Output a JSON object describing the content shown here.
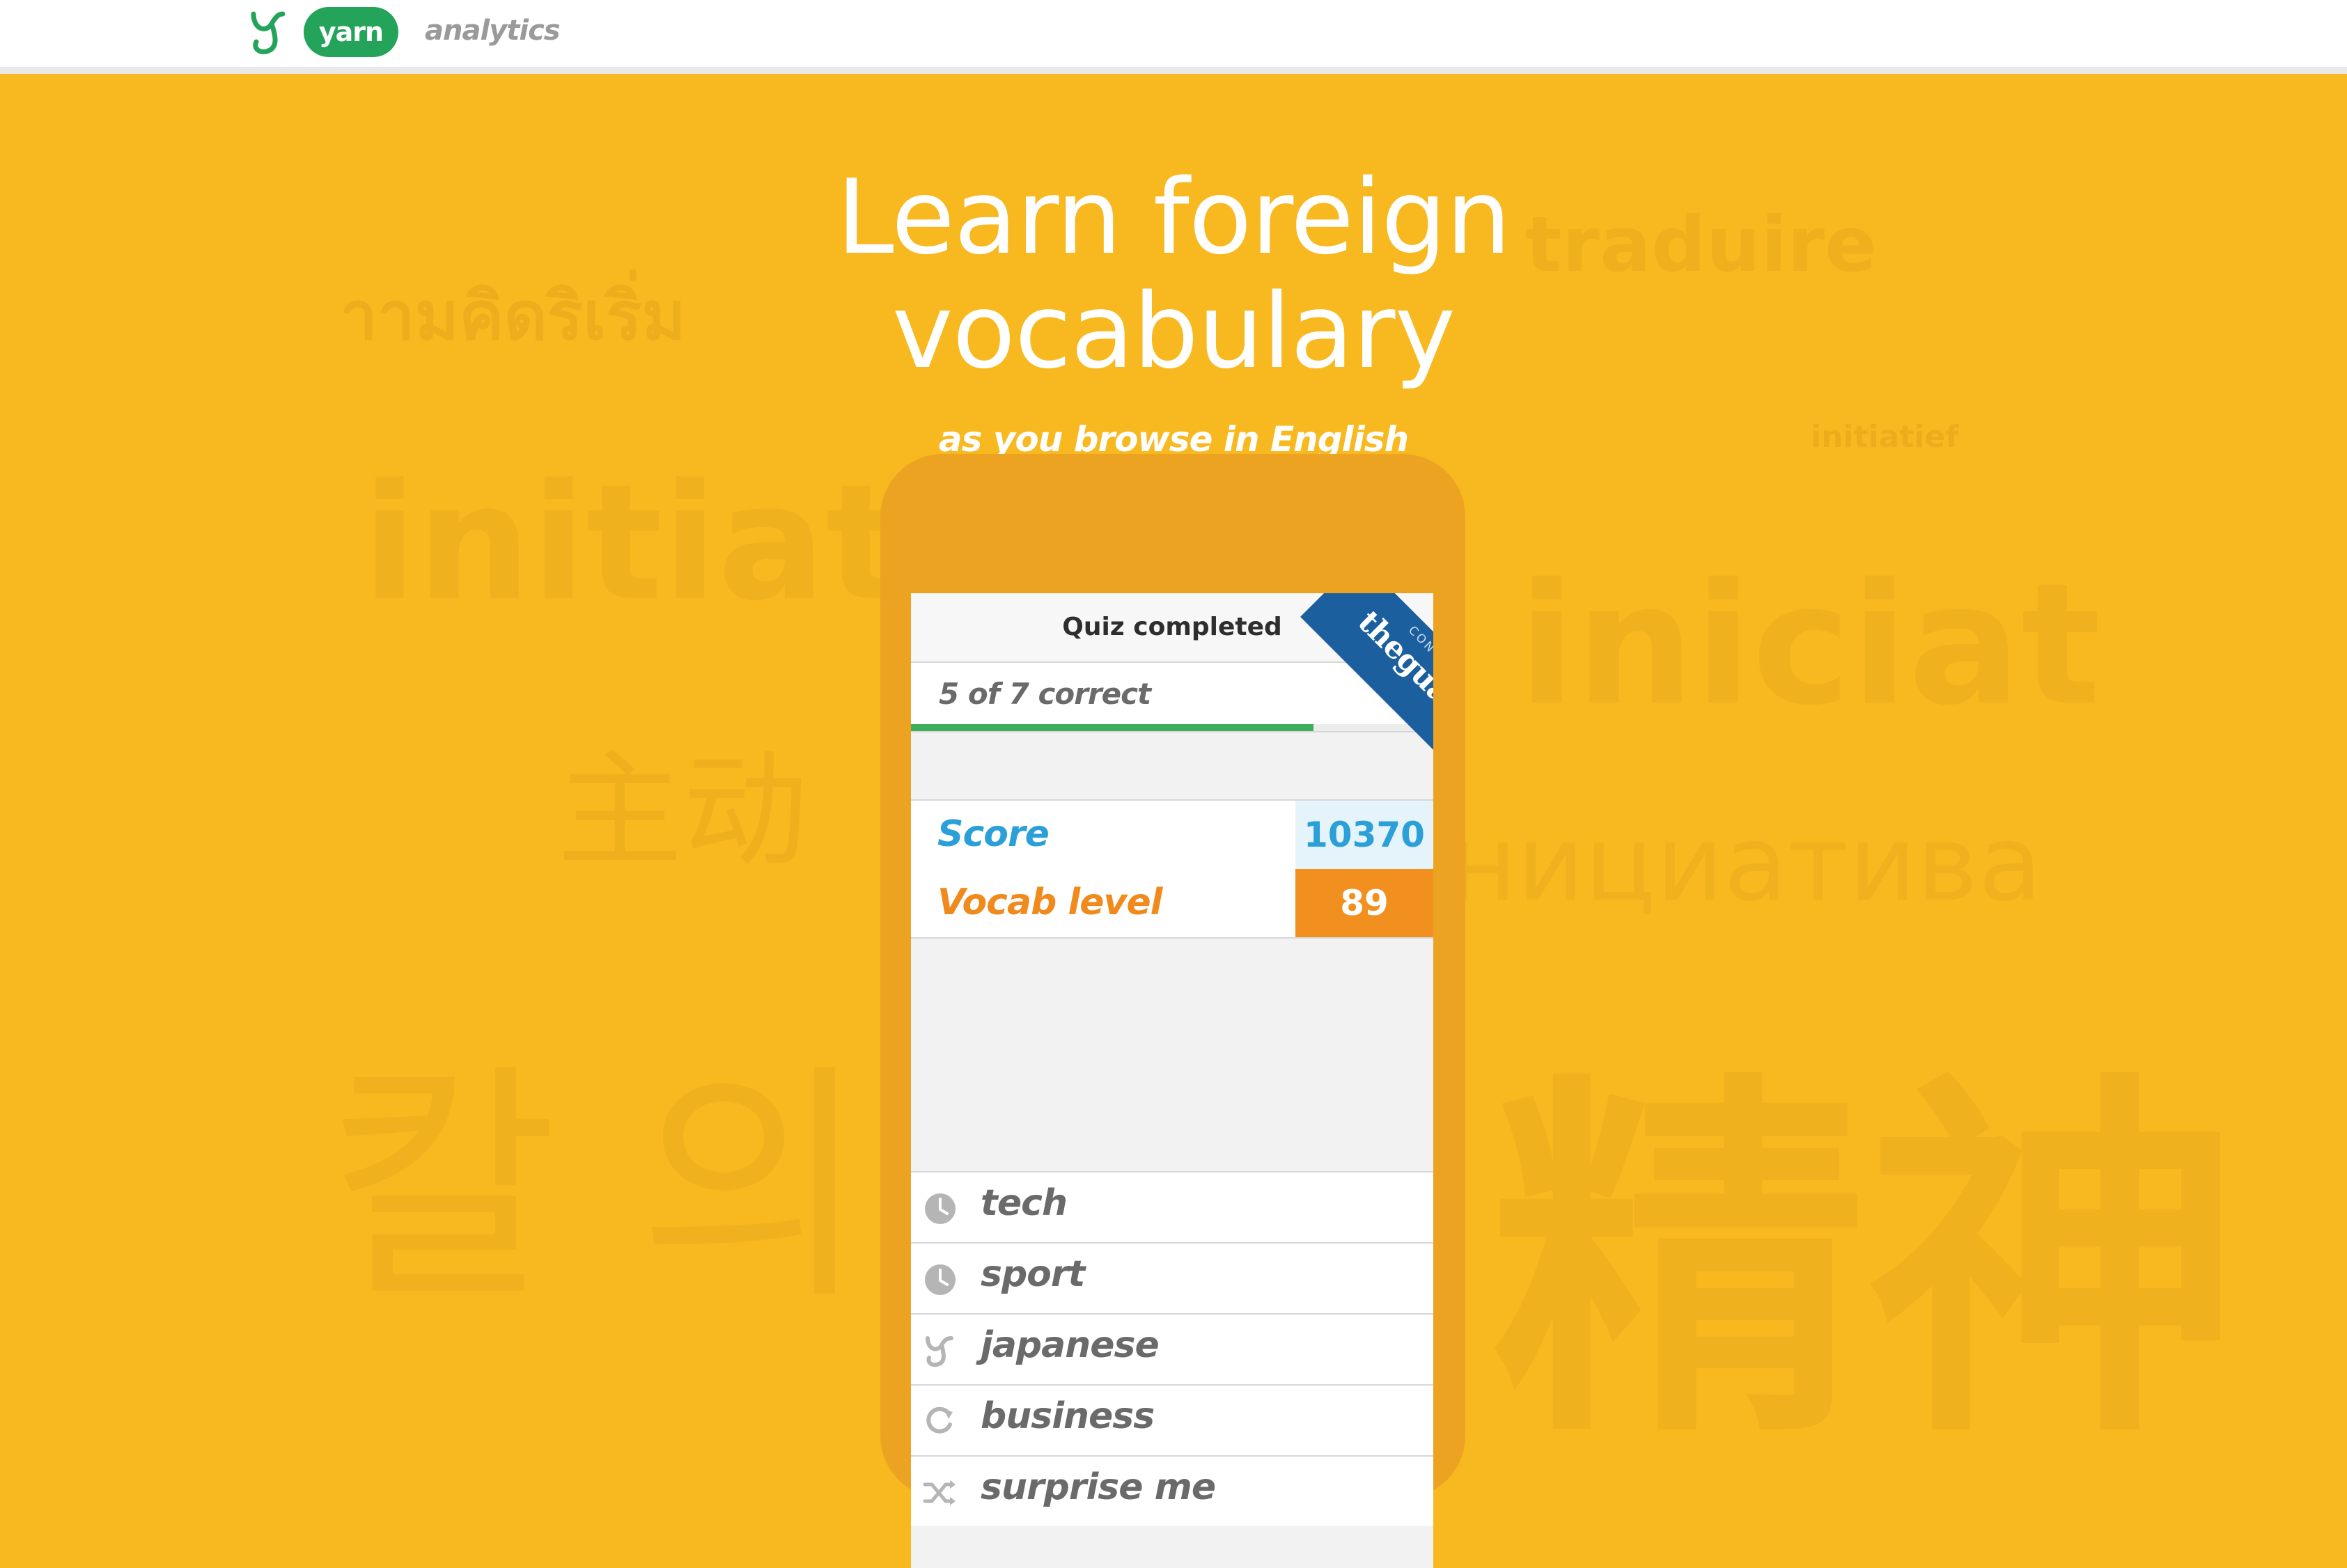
{
  "nav": {
    "brand": "yarn",
    "analytics": "analytics"
  },
  "hero": {
    "headline": "Learn foreign vocabulary",
    "subheadline": "as you browse in English",
    "background_words": [
      "าามคิดริเริ่ม",
      "traduire",
      "initiatief",
      "initiative",
      "iniciat",
      "主动",
      "нициатива",
      "칼 의",
      "精神"
    ]
  },
  "quiz": {
    "title": "Quiz completed",
    "result_text": "5 of 7 correct",
    "progress_fraction": 0.77,
    "ribbon_small": "CONTENT FROM",
    "ribbon_big": "theguardian"
  },
  "stats": {
    "score_label": "Score",
    "score_value": "10370",
    "vocab_label": "Vocab level",
    "vocab_value": "89"
  },
  "topics": [
    {
      "label": "tech",
      "icon": "clock-icon"
    },
    {
      "label": "sport",
      "icon": "clock-icon"
    },
    {
      "label": "japanese",
      "icon": "yarn-logo-icon"
    },
    {
      "label": "business",
      "icon": "refresh-icon"
    },
    {
      "label": "surprise me",
      "icon": "shuffle-icon"
    }
  ],
  "colors": {
    "background": "#f8b920",
    "phone": "#eda322",
    "brand_green": "#23a45a",
    "score_blue": "#2a9fd8",
    "vocab_orange": "#f2901f",
    "guardian_blue": "#1b5f9e"
  }
}
